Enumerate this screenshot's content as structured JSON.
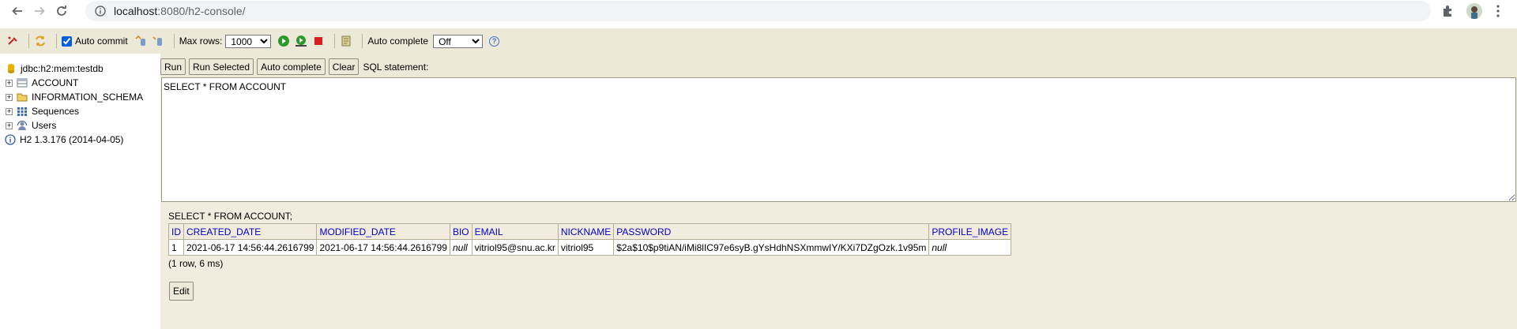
{
  "browser": {
    "url_host": "localhost",
    "url_path": ":8080/h2-console/"
  },
  "toolbar": {
    "auto_commit_label": "Auto commit",
    "auto_commit_checked": true,
    "max_rows_label": "Max rows:",
    "max_rows_value": "1000",
    "auto_complete_label": "Auto complete",
    "auto_complete_value": "Off",
    "help_symbol": "?"
  },
  "tree": {
    "connection": "jdbc:h2:mem:testdb",
    "items": [
      {
        "label": "ACCOUNT",
        "icon": "table-icon"
      },
      {
        "label": "INFORMATION_SCHEMA",
        "icon": "folder-icon"
      },
      {
        "label": "Sequences",
        "icon": "sequences-icon"
      },
      {
        "label": "Users",
        "icon": "users-icon"
      }
    ],
    "version": "H2 1.3.176 (2014-04-05)",
    "expand_symbol": "+"
  },
  "query": {
    "buttons": {
      "run": "Run",
      "run_selected": "Run Selected",
      "auto_complete": "Auto complete",
      "clear": "Clear"
    },
    "sql_label": "SQL statement:",
    "sql_text": "SELECT * FROM ACCOUNT"
  },
  "results": {
    "query_echo": "SELECT * FROM ACCOUNT;",
    "columns": [
      "ID",
      "CREATED_DATE",
      "MODIFIED_DATE",
      "BIO",
      "EMAIL",
      "NICKNAME",
      "PASSWORD",
      "PROFILE_IMAGE"
    ],
    "rows": [
      [
        "1",
        "2021-06-17 14:56:44.2616799",
        "2021-06-17 14:56:44.2616799",
        "null",
        "vitriol95@snu.ac.kr",
        "vitriol95",
        "$2a$10$p9tiAN/iMi8lIC97e6syB.gYsHdhNSXmmwIY/KXi7DZgOzk.1v95m",
        "null"
      ]
    ],
    "status": "(1 row, 6 ms)",
    "edit_label": "Edit"
  },
  "colors": {
    "toolbar_bg": "#ece9d8",
    "results_bg": "#f1ecdd",
    "header_text": "#0000cc"
  }
}
